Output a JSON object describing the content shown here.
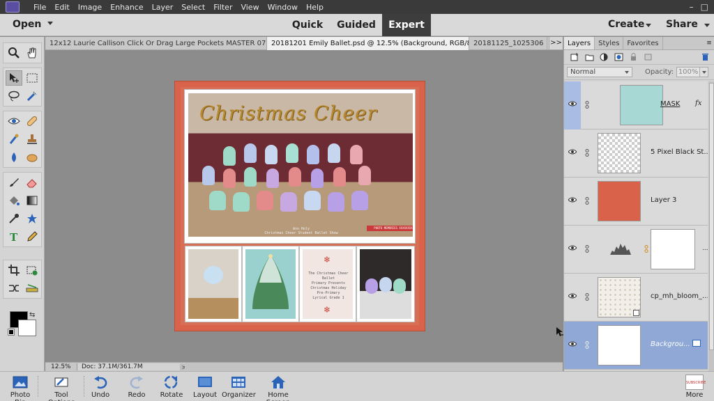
{
  "menubar": {
    "items": [
      "File",
      "Edit",
      "Image",
      "Enhance",
      "Layer",
      "Select",
      "Filter",
      "View",
      "Window",
      "Help"
    ],
    "window_controls": [
      "–",
      "□"
    ]
  },
  "modebar": {
    "open_label": "Open",
    "tabs": [
      "Quick",
      "Guided",
      "Expert"
    ],
    "active_tab": "Expert",
    "create_label": "Create",
    "share_label": "Share"
  },
  "doctabs": [
    {
      "label": "12x12 Laurie Callison Click Or Drag Large Pockets MASTER 07.psd",
      "close": "×"
    },
    {
      "label": "20181201 Emily Ballet.psd @ 12.5% (Background, RGB/8)",
      "close": "×"
    },
    {
      "label": "20181125_1025306",
      "close": ""
    }
  ],
  "doctabs_more": ">>",
  "canvas": {
    "title_art": "Christmas Cheer",
    "photo_caption": "Ann Holy\nChristmas Cheer Student Ballet Show",
    "red_label": "PHOTO MEMORIES XXXXXXXX",
    "card_text": "The Christmas Cheer\nBallet\nPrimary Presents\nChristmas Holiday\nPre-Primary\nLyrical Grade 1"
  },
  "status": {
    "zoom": "12.5%",
    "doc": "Doc: 37.1M/361.7M",
    "arrow": ">"
  },
  "panel": {
    "tabs": [
      "Layers",
      "Styles",
      "Favorites"
    ],
    "active_tab": "Layers",
    "blend_mode": "Normal",
    "opacity_label": "Opacity:",
    "opacity_value": "100%"
  },
  "layers": [
    {
      "name": "MASK",
      "fx": "fx",
      "thumb": "#a7d8d3"
    },
    {
      "name": "5 Pixel Black St...",
      "thumb": "checker"
    },
    {
      "name": "Layer 3",
      "thumb": "#d9634a"
    },
    {
      "name": "",
      "thumb": "histogram",
      "mask": true,
      "more": "..."
    },
    {
      "name": "cp_mh_bloom_...",
      "thumb": "pattern"
    },
    {
      "name": "Backgrou...",
      "thumb": "#ffffff",
      "selected": true
    }
  ],
  "taskbar": {
    "buttons": [
      "Photo Bin",
      "Tool Options",
      "Undo",
      "Redo",
      "Rotate",
      "Layout",
      "Organizer",
      "Home Screen"
    ],
    "more_label": "More",
    "more_badge": "SUBSCRIBE"
  },
  "colors": {
    "accent_tab": "#3d3d3d",
    "page_red": "#d9634a",
    "selected_layer": "#8fa8d6"
  }
}
